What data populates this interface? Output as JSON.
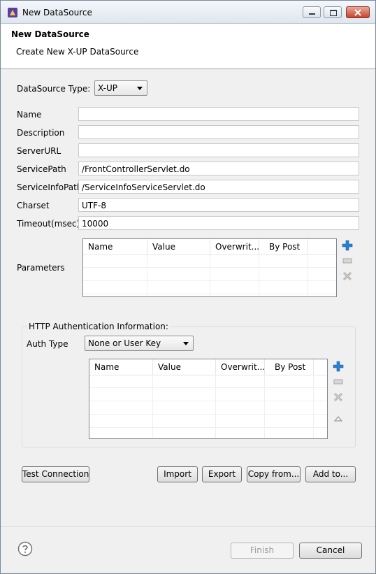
{
  "window": {
    "title": "New DataSource"
  },
  "header": {
    "title": "New DataSource",
    "subtitle": "Create New X-UP DataSource"
  },
  "datasource_type": {
    "label": "DataSource Type:",
    "value": "X-UP"
  },
  "fields": {
    "name": {
      "label": "Name",
      "value": ""
    },
    "description": {
      "label": "Description",
      "value": ""
    },
    "server_url": {
      "label": "ServerURL",
      "value": ""
    },
    "service_path": {
      "label": "ServicePath",
      "value": "/FrontControllerServlet.do"
    },
    "service_info_path": {
      "label": "ServiceInfoPath",
      "value": "/ServiceInfoServiceServlet.do"
    },
    "charset": {
      "label": "Charset",
      "value": "UTF-8"
    },
    "timeout": {
      "label": "Timeout(msec)",
      "value": "10000"
    }
  },
  "parameters": {
    "label": "Parameters",
    "columns": [
      "Name",
      "Value",
      "Overwrit...",
      "By Post"
    ]
  },
  "auth": {
    "group_title": "HTTP Authentication Information:",
    "type_label": "Auth Type",
    "type_value": "None or User Key",
    "columns": [
      "Name",
      "Value",
      "Overwrit...",
      "By Post"
    ]
  },
  "buttons": {
    "test_connection": "Test Connection",
    "import": "Import",
    "export": "Export",
    "copy_from": "Copy from...",
    "add_to": "Add to...",
    "finish": "Finish",
    "cancel": "Cancel"
  },
  "icons": {
    "add": "plus-icon",
    "edit": "edit-icon",
    "delete": "delete-icon",
    "up": "move-up-icon",
    "help": "help-icon"
  },
  "colors": {
    "add_icon": "#2a7fd4",
    "disabled_text": "#9b9b9b"
  }
}
